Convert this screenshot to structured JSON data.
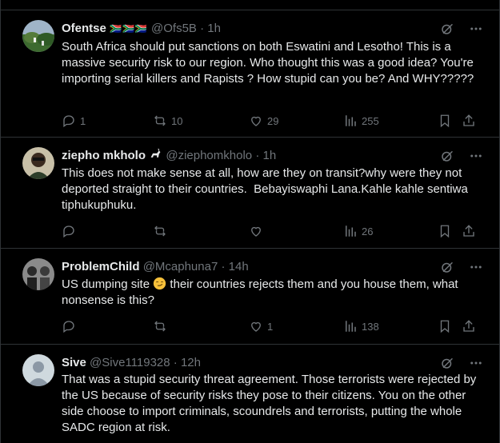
{
  "colors": {
    "background": "#000000",
    "text": "#e7e9ea",
    "muted": "#71767b",
    "divider": "#2f3336"
  },
  "posts": [
    {
      "display_name": "Ofentse",
      "flags": "🇿🇦🇿🇦🇿🇦",
      "handle": "@Ofs5B",
      "dot": "·",
      "time": "1h",
      "text": "South Africa should put sanctions on both Eswatini and Lesotho! This is a massive security risk to our region. Who thought this was a good idea? You're importing serial killers and Rapists ? How stupid can you be? And WHY?????",
      "replies": "1",
      "reposts": "10",
      "likes": "29",
      "views": "255"
    },
    {
      "display_name": "ziepho mkholo",
      "handle": "@ziephomkholo",
      "dot": "·",
      "time": "1h",
      "text": "This does not make sense at all, how are they on transit?why were they not deported straight to their countries.  Bebayiswaphi Lana.Kahle kahle sentiwa tiphukuphuku.",
      "replies": "",
      "reposts": "",
      "likes": "",
      "views": "26"
    },
    {
      "display_name": "ProblemChild",
      "handle": "@Mcaphuna7",
      "dot": "·",
      "time": "14h",
      "text_before": "US dumping site ",
      "text_after": " their countries rejects them and you house them, what nonsense is this?",
      "replies": "",
      "reposts": "",
      "likes": "1",
      "views": "138"
    },
    {
      "display_name": "Sive",
      "handle": "@Sive1119328",
      "dot": "·",
      "time": "12h",
      "text": "That was a stupid security threat agreement. Those terrorists were rejected by the US because of security risks they pose to their citizens. You on the other side choose to import criminals, scoundrels and terrorists, putting the whole SADC region at risk."
    }
  ],
  "icons": {
    "grok": "grok-icon",
    "more": "more-icon",
    "reply": "reply-icon",
    "repost": "repost-icon",
    "like": "like-icon",
    "views": "views-icon",
    "bookmark": "bookmark-icon",
    "share": "share-icon",
    "goat_emoji": "goat-emoji-icon",
    "smirk_emoji": "smirk-emoji-icon"
  }
}
